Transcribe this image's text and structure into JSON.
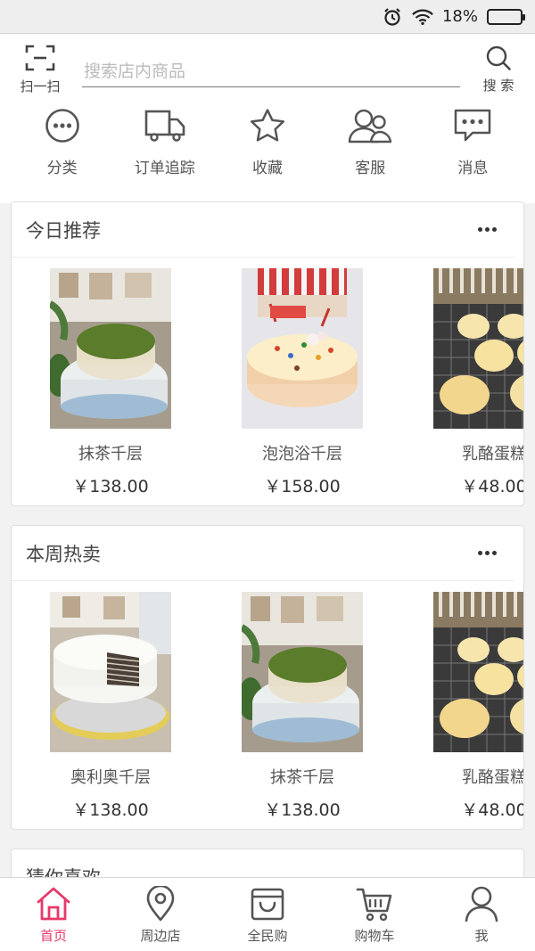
{
  "status_bar": {
    "battery_text": "18%",
    "battery_level": 0.18
  },
  "header": {
    "scan_label": "扫一扫",
    "search_placeholder": "搜索店内商品",
    "search_label": "搜 索"
  },
  "quick_menu": [
    {
      "label": "分类",
      "icon": "more-circle-icon"
    },
    {
      "label": "订单追踪",
      "icon": "truck-icon"
    },
    {
      "label": "收藏",
      "icon": "star-icon"
    },
    {
      "label": "客服",
      "icon": "customer-service-icon"
    },
    {
      "label": "消息",
      "icon": "message-icon"
    }
  ],
  "sections": [
    {
      "title": "今日推荐",
      "products": [
        {
          "name": "抹茶千层",
          "price": "￥138.00",
          "image": "matcha-crepe-cake"
        },
        {
          "name": "泡泡浴千层",
          "price": "￥158.00",
          "image": "bubble-bath-crepe-cake"
        },
        {
          "name": "乳酪蛋糕",
          "price": "￥48.00",
          "image": "cheese-cakes-on-rack"
        }
      ]
    },
    {
      "title": "本周热卖",
      "products": [
        {
          "name": "奥利奥千层",
          "price": "￥138.00",
          "image": "oreo-crepe-cake"
        },
        {
          "name": "抹茶千层",
          "price": "￥138.00",
          "image": "matcha-crepe-cake"
        },
        {
          "name": "乳酪蛋糕",
          "price": "￥48.00",
          "image": "cheese-cakes-on-rack"
        }
      ]
    },
    {
      "title": "猜你喜欢",
      "products": []
    }
  ],
  "tabbar": [
    {
      "label": "首页",
      "icon": "home-icon",
      "active": true
    },
    {
      "label": "周边店",
      "icon": "location-pin-icon",
      "active": false
    },
    {
      "label": "全民购",
      "icon": "shopping-bag-icon",
      "active": false
    },
    {
      "label": "购物车",
      "icon": "cart-icon",
      "active": false
    },
    {
      "label": "我",
      "icon": "user-icon",
      "active": false
    }
  ],
  "colors": {
    "accent": "#e6396a",
    "icon": "#555555"
  }
}
